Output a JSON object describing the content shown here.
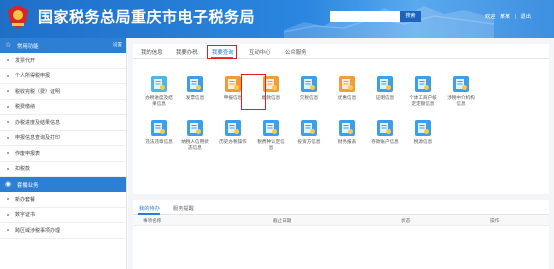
{
  "header": {
    "site_title": "国家税务总局重庆市电子税务局",
    "search": {
      "placeholder": "",
      "button_label": "搜索"
    },
    "links": [
      "欢迎",
      "退出"
    ],
    "username": "某某",
    "separator": "|",
    "colors": {
      "primary": "#2a86e0",
      "highlight": "#e02020"
    }
  },
  "sidebar": {
    "section1": {
      "title": "常用功能",
      "action": "设置",
      "icon": "star-icon"
    },
    "items1": [
      "发票代开",
      "个人所得税申报",
      "税收完税（费）证明",
      "税费缴纳",
      "办税进度及结果信息",
      "申报信息查询及打印",
      "作废申报表",
      "扣税款"
    ],
    "section2": {
      "title": "套餐业务",
      "icon": "package-icon"
    },
    "items2": [
      "新办套餐",
      "数字证书",
      "跨区域涉税事项办理"
    ]
  },
  "tabs": [
    "我的信息",
    "我要办税",
    "我要查询",
    "互动中心",
    "公众服务"
  ],
  "active_tab": "我要查询",
  "functions": [
    {
      "label": "办税进度及结",
      "label2": "果信息",
      "icon": "progress-icon",
      "color": "#4fb4e6"
    },
    {
      "label": "发票信息",
      "label2": "",
      "icon": "invoice-icon",
      "color": "#3e9ee8"
    },
    {
      "label": "申报信息",
      "label2": "",
      "icon": "declaration-icon",
      "color": "#f29a38"
    },
    {
      "label": "缴款信息",
      "label2": "",
      "icon": "payment-icon",
      "color": "#f09d3a"
    },
    {
      "label": "欠税信息",
      "label2": "",
      "icon": "arrears-icon",
      "color": "#3e9ee8"
    },
    {
      "label": "优惠信息",
      "label2": "",
      "icon": "preference-icon",
      "color": "#f09d3a"
    },
    {
      "label": "证明信息",
      "label2": "",
      "icon": "certificate-icon",
      "color": "#3e9ee8"
    },
    {
      "label": "个体工商户核",
      "label2": "定定额信息",
      "icon": "business-icon",
      "color": "#3e9ee8"
    },
    {
      "label": "涉税中介机构",
      "label2": "信息",
      "icon": "agency-icon",
      "color": "#3e9ee8"
    },
    {
      "label": "违法违章信息",
      "label2": "",
      "icon": "violation-icon",
      "color": "#3e9ee8"
    },
    {
      "label": "纳税人信用状",
      "label2": "态信息",
      "icon": "credit-icon",
      "color": "#3e9ee8"
    },
    {
      "label": "历史办税操作",
      "label2": "",
      "icon": "history-icon",
      "color": "#3e9ee8"
    },
    {
      "label": "税费种认定信",
      "label2": "息",
      "icon": "tax-type-icon",
      "color": "#3e9ee8"
    },
    {
      "label": "投资方信息",
      "label2": "",
      "icon": "investor-icon",
      "color": "#3e9ee8"
    },
    {
      "label": "财务报表",
      "label2": "",
      "icon": "financial-report-icon",
      "color": "#3e9ee8"
    },
    {
      "label": "存款账户信息",
      "label2": "",
      "icon": "bank-account-icon",
      "color": "#3e9ee8"
    },
    {
      "label": "税源信息",
      "label2": "",
      "icon": "tax-source-icon",
      "color": "#3e9ee8"
    }
  ],
  "bottom": {
    "tabs": [
      "我的待办",
      "服务提醒"
    ],
    "columns": [
      "事项名称",
      "截止日期",
      "状态",
      "操作"
    ]
  }
}
